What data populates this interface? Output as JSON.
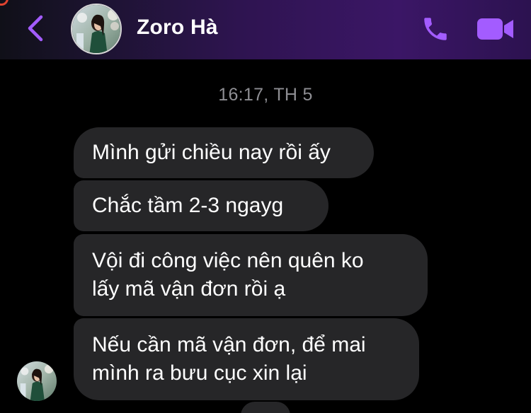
{
  "header": {
    "contact_name": "Zoro Hà",
    "back_icon": "chevron-left-icon",
    "call_icon": "phone-icon",
    "video_icon": "video-camera-icon",
    "accent_color": "#a35cff"
  },
  "conversation": {
    "timestamp": "16:17, TH 5",
    "messages": [
      {
        "text": "Mình gửi chiều nay rồi ấy"
      },
      {
        "text": "Chắc tầm 2-3 ngayg"
      },
      {
        "text": "Vội đi công việc  nên quên ko\nlấy mã vận đơn rồi ạ"
      },
      {
        "text": "Nếu cần mã vận đơn, để mai\nmình ra bưu cục xin lại"
      }
    ]
  },
  "colors": {
    "background": "#000000",
    "bubble": "#262628",
    "timestamp_text": "#8e8e93",
    "notification_ring": "#e0432f"
  }
}
